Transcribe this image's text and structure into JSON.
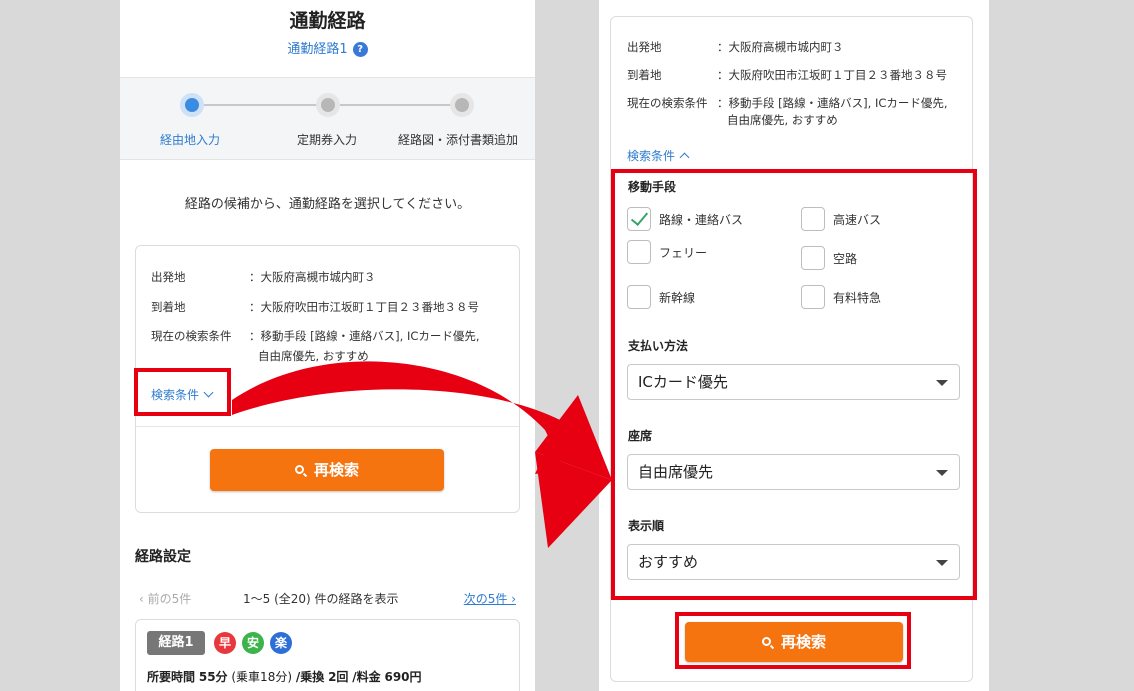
{
  "left": {
    "title": "通勤経路",
    "subtitle": "通勤経路1",
    "help_icon": "?",
    "steps": [
      {
        "label": "経由地入力",
        "active": true
      },
      {
        "label": "定期券入力",
        "active": false
      },
      {
        "label": "経路図・添付書類追加",
        "active": false
      }
    ],
    "instruction": "経路の候補から、通勤経路を選択してください。",
    "info": {
      "origin_key": "出発地",
      "origin_val": "：大阪府高槻市城内町３",
      "dest_key": "到着地",
      "dest_val": "：大阪府吹田市江坂町１丁目２３番地３８号",
      "cond_key": "現在の検索条件",
      "cond_val_1": "：移動手段 [路線・連絡バス], ICカード優先,",
      "cond_val_2": "自由席優先, おすすめ"
    },
    "cond_link": "検索条件",
    "search_button": "再検索",
    "section_title": "経路設定",
    "pager": {
      "prev": "‹ 前の5件",
      "range": "1～5 (全20) 件の経路を表示",
      "next": "次の5件"
    },
    "route": {
      "tag": "経路1",
      "badges": [
        {
          "text": "早",
          "color": "#e8383d"
        },
        {
          "text": "安",
          "color": "#3cb44b"
        },
        {
          "text": "楽",
          "color": "#2d6fd6"
        }
      ],
      "time_label": "所要時間",
      "time_value": "55分",
      "ride": "(乗車18分)",
      "transfer_label": "/乗換",
      "transfer_value": "2回",
      "fare_label": "/料金",
      "fare_value": "690円"
    }
  },
  "right": {
    "info": {
      "origin_key": "出発地",
      "origin_val": "：大阪府高槻市城内町３",
      "dest_key": "到着地",
      "dest_val": "：大阪府吹田市江坂町１丁目２３番地３８号",
      "cond_key": "現在の検索条件",
      "cond_val_1": "：移動手段 [路線・連絡バス], ICカード優先,",
      "cond_val_2": "自由席優先, おすすめ"
    },
    "cond_link": "検索条件",
    "transport_label": "移動手段",
    "transport_options": [
      {
        "label": "路線・連絡バス",
        "checked": true
      },
      {
        "label": "高速バス",
        "checked": false
      },
      {
        "label": "フェリー",
        "checked": false
      },
      {
        "label": "空路",
        "checked": false
      },
      {
        "label": "新幹線",
        "checked": false
      },
      {
        "label": "有料特急",
        "checked": false
      }
    ],
    "payment_label": "支払い方法",
    "payment_value": "ICカード優先",
    "seat_label": "座席",
    "seat_value": "自由席優先",
    "order_label": "表示順",
    "order_value": "おすすめ",
    "search_button": "再検索"
  },
  "colors": {
    "accent": "#f5740f",
    "link": "#2f7ccf",
    "highlight": "#e60012"
  }
}
